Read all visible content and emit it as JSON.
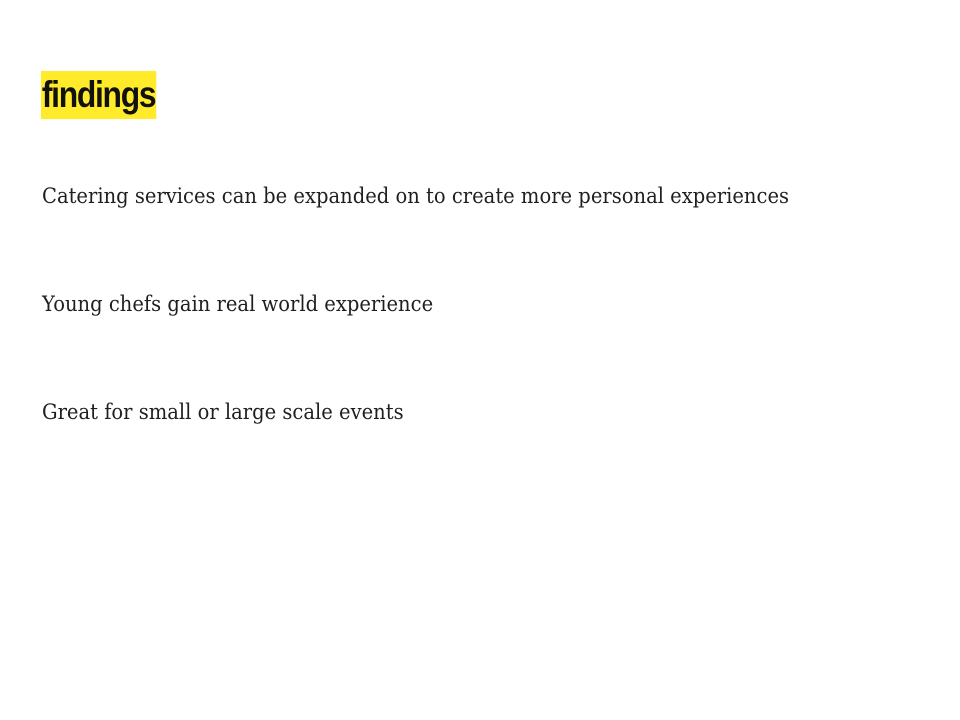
{
  "slide": {
    "title": "findings",
    "title_highlight_color": "#ffeb29",
    "bullets": [
      "Catering services can be expanded on to create more personal experiences",
      "Young chefs gain real world experience",
      "Great for small or large scale events"
    ]
  }
}
